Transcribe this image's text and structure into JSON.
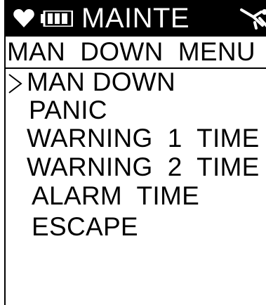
{
  "header": {
    "title": "MAINTE",
    "heart_icon": "heart-icon",
    "battery_icon": "battery-icon",
    "status_icon": "man-down-status-icon"
  },
  "menu": {
    "title": "MAN  DOWN  MENU",
    "cursor_icon": "chevron-right-icon",
    "items": [
      {
        "label": "MAN DOWN",
        "selected": true
      },
      {
        "label": "PANIC",
        "selected": false
      },
      {
        "label": "WARNING  1  TIME",
        "selected": false
      },
      {
        "label": "WARNING  2  TIME",
        "selected": false
      },
      {
        "label": "ALARM  TIME",
        "selected": false
      },
      {
        "label": "ESCAPE",
        "selected": false
      }
    ]
  },
  "colors": {
    "background": "#ffffff",
    "foreground": "#000000",
    "header_text": "#ffffff"
  }
}
